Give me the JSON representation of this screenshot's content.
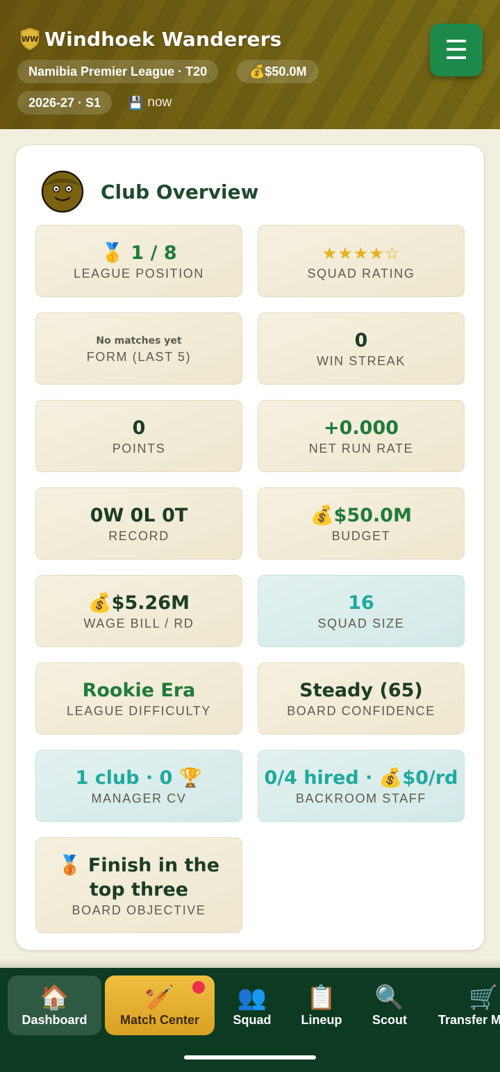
{
  "header": {
    "crest_text": "WW",
    "club_name": "Windhoek Wanderers",
    "league_chip": "Namibia Premier League · T20",
    "budget_chip": "💰$50.0M",
    "season_chip": "2026-27 · S1",
    "saved_icon": "floppy-disk-icon",
    "saved_label": "now",
    "menu_icon": "☰"
  },
  "overview": {
    "title": "Club Overview",
    "tiles": [
      {
        "value": "🥇 1 / 8",
        "label": "LEAGUE POSITION"
      },
      {
        "value": "★★★★☆",
        "label": "SQUAD RATING",
        "rating": 4,
        "rating_max": 5
      },
      {
        "value": "No matches yet",
        "label": "FORM (LAST 5)"
      },
      {
        "value": "0",
        "label": "WIN STREAK"
      },
      {
        "value": "0",
        "label": "POINTS"
      },
      {
        "value": "+0.000",
        "label": "NET RUN RATE"
      },
      {
        "value": "0W 0L 0T",
        "label": "RECORD"
      },
      {
        "value": "💰$50.0M",
        "label": "BUDGET"
      },
      {
        "value": "💰$5.26M",
        "label": "WAGE BILL / RD"
      },
      {
        "value": "16",
        "label": "SQUAD SIZE"
      },
      {
        "value": "Rookie Era",
        "label": "LEAGUE DIFFICULTY"
      },
      {
        "value": "Steady (65)",
        "label": "BOARD CONFIDENCE"
      },
      {
        "value": "1 club · 0 🏆",
        "label": "MANAGER CV"
      },
      {
        "value": "0/4 hired · 💰$0/rd",
        "label": "BACKROOM STAFF"
      },
      {
        "value_line1": "🥉 Finish in the",
        "value_line2": "top three",
        "label": "BOARD OBJECTIVE"
      }
    ]
  },
  "nav": {
    "items": [
      {
        "icon": "🏠",
        "label": "Dashboard"
      },
      {
        "icon": "🏏",
        "label": "Match Center"
      },
      {
        "icon": "👥",
        "label": "Squad"
      },
      {
        "icon": "📋",
        "label": "Lineup"
      },
      {
        "icon": "🔍",
        "label": "Scout"
      },
      {
        "icon": "🛒",
        "label": "Transfer M"
      }
    ]
  },
  "colors": {
    "header_olive": "#6f6214",
    "menu_green": "#1d8a4c",
    "title_green": "#1f4a2e",
    "value_green": "#1f7a3c",
    "value_teal": "#1fa99d",
    "nav_bg": "#0d3a22",
    "match_gold": "#e0aa2b",
    "notif_red": "#e8324a"
  }
}
